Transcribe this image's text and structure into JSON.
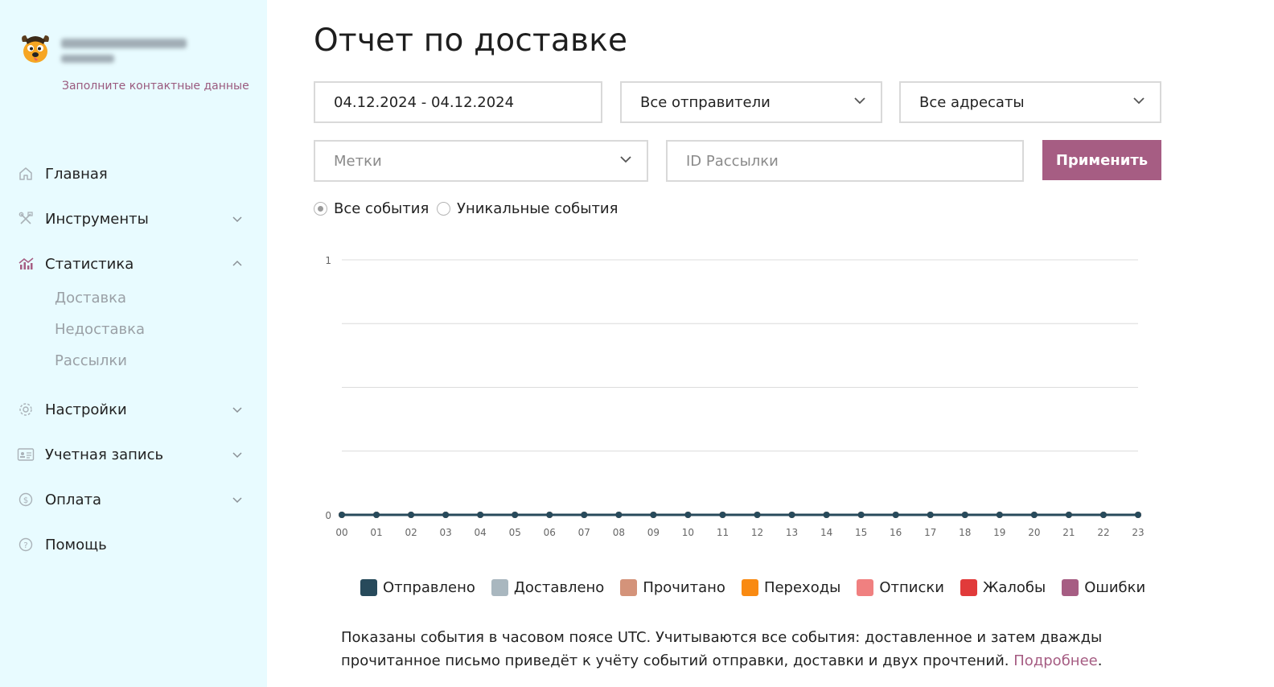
{
  "sidebar": {
    "contact_link": "Заполните контактные данные",
    "nav": [
      {
        "label": "Главная",
        "icon": "home-icon"
      },
      {
        "label": "Инструменты",
        "icon": "tools-icon"
      },
      {
        "label": "Статистика",
        "icon": "stats-icon",
        "expanded": true,
        "children": [
          {
            "label": "Доставка"
          },
          {
            "label": "Недоставка"
          },
          {
            "label": "Рассылки"
          }
        ]
      },
      {
        "label": "Настройки",
        "icon": "gear-icon"
      },
      {
        "label": "Учетная запись",
        "icon": "id-card-icon"
      },
      {
        "label": "Оплата",
        "icon": "coin-icon"
      },
      {
        "label": "Помощь",
        "icon": "help-icon"
      }
    ]
  },
  "main": {
    "title": "Отчет по доставке",
    "filters": {
      "date_range": "04.12.2024 - 04.12.2024",
      "senders": "Все отправители",
      "recipients": "Все адресаты",
      "tags_placeholder": "Метки",
      "mailing_id_placeholder": "ID Рассылки",
      "apply_label": "Применить"
    },
    "event_mode": {
      "all_label": "Все события",
      "unique_label": "Уникальные события",
      "selected": "all"
    },
    "note": {
      "text": "Показаны события в часовом поясе UTC. Учитываются все события: доставленное и затем дважды прочитанное письмо приведёт к учёту событий отправки, доставки и двух прочтений.",
      "link": "Подробнее",
      "end": "."
    }
  },
  "colors": {
    "accent": "#a65d83",
    "sidebar_bg": "#e8fbff"
  },
  "chart_data": {
    "type": "line",
    "categories": [
      "00",
      "01",
      "02",
      "03",
      "04",
      "05",
      "06",
      "07",
      "08",
      "09",
      "10",
      "11",
      "12",
      "13",
      "14",
      "15",
      "16",
      "17",
      "18",
      "19",
      "20",
      "21",
      "22",
      "23"
    ],
    "ylim": [
      0,
      1
    ],
    "y_ticks": [
      "0",
      "1"
    ],
    "grid": true,
    "legend_position": "bottom",
    "series": [
      {
        "name": "Отправлено",
        "color": "#274a5b",
        "values": [
          0,
          0,
          0,
          0,
          0,
          0,
          0,
          0,
          0,
          0,
          0,
          0,
          0,
          0,
          0,
          0,
          0,
          0,
          0,
          0,
          0,
          0,
          0,
          0
        ]
      },
      {
        "name": "Доставлено",
        "color": "#a9b7bf",
        "values": [
          0,
          0,
          0,
          0,
          0,
          0,
          0,
          0,
          0,
          0,
          0,
          0,
          0,
          0,
          0,
          0,
          0,
          0,
          0,
          0,
          0,
          0,
          0,
          0
        ]
      },
      {
        "name": "Прочитано",
        "color": "#d4937a",
        "values": [
          0,
          0,
          0,
          0,
          0,
          0,
          0,
          0,
          0,
          0,
          0,
          0,
          0,
          0,
          0,
          0,
          0,
          0,
          0,
          0,
          0,
          0,
          0,
          0
        ]
      },
      {
        "name": "Переходы",
        "color": "#f98a12",
        "values": [
          0,
          0,
          0,
          0,
          0,
          0,
          0,
          0,
          0,
          0,
          0,
          0,
          0,
          0,
          0,
          0,
          0,
          0,
          0,
          0,
          0,
          0,
          0,
          0
        ]
      },
      {
        "name": "Отписки",
        "color": "#f08080",
        "values": [
          0,
          0,
          0,
          0,
          0,
          0,
          0,
          0,
          0,
          0,
          0,
          0,
          0,
          0,
          0,
          0,
          0,
          0,
          0,
          0,
          0,
          0,
          0,
          0
        ]
      },
      {
        "name": "Жалобы",
        "color": "#e13a3a",
        "values": [
          0,
          0,
          0,
          0,
          0,
          0,
          0,
          0,
          0,
          0,
          0,
          0,
          0,
          0,
          0,
          0,
          0,
          0,
          0,
          0,
          0,
          0,
          0,
          0
        ]
      },
      {
        "name": "Ошибки",
        "color": "#a65d83",
        "values": [
          0,
          0,
          0,
          0,
          0,
          0,
          0,
          0,
          0,
          0,
          0,
          0,
          0,
          0,
          0,
          0,
          0,
          0,
          0,
          0,
          0,
          0,
          0,
          0
        ]
      }
    ]
  }
}
